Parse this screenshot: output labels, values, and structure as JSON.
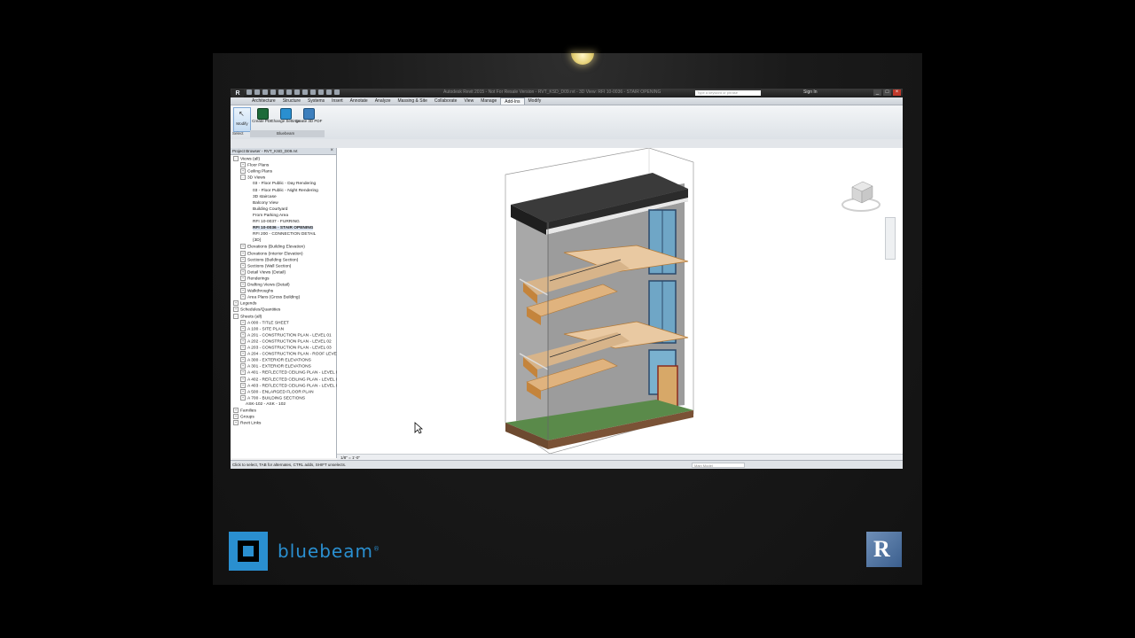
{
  "app": {
    "logo": "R",
    "title": "Autodesk Revit 2015 - Not For Resale Version - RVT_KSD_D09.rvt - 3D View: RFI 10-0036 - STAIR OPENING",
    "search_placeholder": "Type a keyword or phrase",
    "sign_in": "Sign In"
  },
  "ribbon": {
    "tabs": [
      "Architecture",
      "Structure",
      "Systems",
      "Insert",
      "Annotate",
      "Analyze",
      "Massing & Site",
      "Collaborate",
      "View",
      "Manage",
      "Add-Ins",
      "Modify"
    ],
    "active_tab": "Add-Ins",
    "modify_label": "Modify",
    "select_label": "Select",
    "buttons": [
      {
        "label": "Create PDF",
        "icon": "create-pdf-icon"
      },
      {
        "label": "Change Settings",
        "icon": "change-settings-icon"
      },
      {
        "label": "Create 3D PDF",
        "icon": "create-3d-pdf-icon"
      }
    ],
    "panel_label": "Bluebeam"
  },
  "project_browser": {
    "title": "Project Browser - RVT_KSD_D09.rvt",
    "items": [
      {
        "label": "Views (all)",
        "indent": 0,
        "toggle": "-"
      },
      {
        "label": "Floor Plans",
        "indent": 1,
        "toggle": "+"
      },
      {
        "label": "Ceiling Plans",
        "indent": 1,
        "toggle": "+"
      },
      {
        "label": "3D Views",
        "indent": 1,
        "toggle": "-"
      },
      {
        "label": "03 - Floor Public - Day Rendering",
        "indent": 2
      },
      {
        "label": "03 - Floor Public - Night Rendering",
        "indent": 2
      },
      {
        "label": "3D staircase",
        "indent": 2
      },
      {
        "label": "Balcony View",
        "indent": 2
      },
      {
        "label": "Building Courtyard",
        "indent": 2
      },
      {
        "label": "From Parking Area",
        "indent": 2
      },
      {
        "label": "RFI 10-0037 - FURRING",
        "indent": 2
      },
      {
        "label": "RFI 10-0036 - STAIR OPENING",
        "indent": 2,
        "selected": true
      },
      {
        "label": "RFI 200 - CONNECTION DETAIL",
        "indent": 2
      },
      {
        "label": "{3D}",
        "indent": 2
      },
      {
        "label": "Elevations (Building Elevation)",
        "indent": 1,
        "toggle": "+"
      },
      {
        "label": "Elevations (Interior Elevation)",
        "indent": 1,
        "toggle": "+"
      },
      {
        "label": "Sections (Building Section)",
        "indent": 1,
        "toggle": "+"
      },
      {
        "label": "Sections (Wall Section)",
        "indent": 1,
        "toggle": "+"
      },
      {
        "label": "Detail Views (Detail)",
        "indent": 1,
        "toggle": "+"
      },
      {
        "label": "Renderings",
        "indent": 1,
        "toggle": "+"
      },
      {
        "label": "Drafting Views (Detail)",
        "indent": 1,
        "toggle": "+"
      },
      {
        "label": "Walkthroughs",
        "indent": 1,
        "toggle": "+"
      },
      {
        "label": "Area Plans (Gross Building)",
        "indent": 1,
        "toggle": "+"
      },
      {
        "label": "Legends",
        "indent": 0,
        "toggle": "+"
      },
      {
        "label": "Schedules/Quantities",
        "indent": 0,
        "toggle": "+"
      },
      {
        "label": "Sheets (all)",
        "indent": 0,
        "toggle": "-"
      },
      {
        "label": "A 000 - TITLE SHEET",
        "indent": 1,
        "toggle": "+"
      },
      {
        "label": "A 100 - SITE PLAN",
        "indent": 1,
        "toggle": "+"
      },
      {
        "label": "A 201 - CONSTRUCTION PLAN - LEVEL 01",
        "indent": 1,
        "toggle": "+"
      },
      {
        "label": "A 202 - CONSTRUCTION PLAN - LEVEL 02",
        "indent": 1,
        "toggle": "+"
      },
      {
        "label": "A 203 - CONSTRUCTION PLAN - LEVEL 03",
        "indent": 1,
        "toggle": "+"
      },
      {
        "label": "A 204 - CONSTRUCTION PLAN - ROOF LEVEL",
        "indent": 1,
        "toggle": "+"
      },
      {
        "label": "A 300 - EXTERIOR ELEVATIONS",
        "indent": 1,
        "toggle": "+"
      },
      {
        "label": "A 301 - EXTERIOR ELEVATIONS",
        "indent": 1,
        "toggle": "+"
      },
      {
        "label": "A 401 - REFLECTED CEILING PLAN - LEVEL 01",
        "indent": 1,
        "toggle": "+"
      },
      {
        "label": "A 402 - REFLECTED CEILING PLAN - LEVEL 02",
        "indent": 1,
        "toggle": "+"
      },
      {
        "label": "A 403 - REFLECTED CEILING PLAN - LEVEL 03",
        "indent": 1,
        "toggle": "+"
      },
      {
        "label": "A 500 - ENLARGED FLOOR PLAN",
        "indent": 1,
        "toggle": "+"
      },
      {
        "label": "A 700 - BUILDING SECTIONS",
        "indent": 1,
        "toggle": "+"
      },
      {
        "label": "ASK-102 - ASK - 102",
        "indent": 1
      },
      {
        "label": "Families",
        "indent": 0,
        "toggle": "+"
      },
      {
        "label": "Groups",
        "indent": 0,
        "toggle": "+"
      },
      {
        "label": "Revit Links",
        "indent": 0,
        "toggle": "+"
      }
    ]
  },
  "viewport": {
    "scale": "1/8\" = 1'-0\""
  },
  "status": {
    "text": "Click to select, TAB for alternates, CTRL adds, SHIFT unselects.",
    "model": "Main Model"
  },
  "branding": {
    "bluebeam": "bluebeam",
    "registered": "®",
    "revit_letter": "R"
  }
}
